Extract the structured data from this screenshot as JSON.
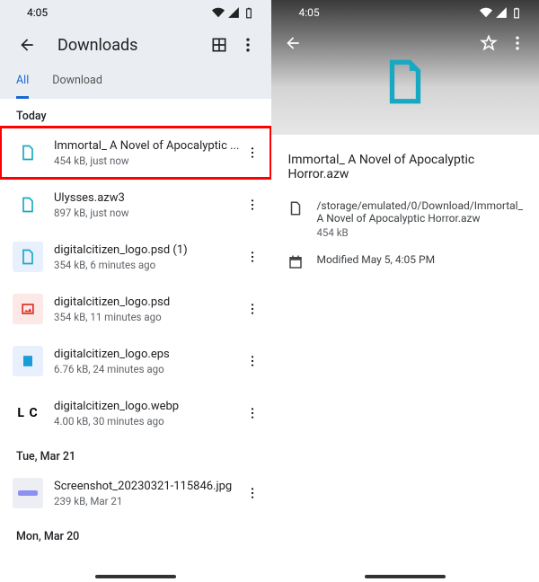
{
  "status": {
    "time": "4:05"
  },
  "left": {
    "title": "Downloads",
    "tabs": {
      "all": "All",
      "download": "Download"
    },
    "sections": {
      "today": "Today",
      "mar21": "Tue, Mar 21",
      "mar20": "Mon, Mar 20"
    },
    "files": {
      "f0": {
        "name": "Immortal_ A Novel of Apocalyptic ...",
        "meta": "454 kB, just now"
      },
      "f1": {
        "name": "Ulysses.azw3",
        "meta": "897 kB, just now"
      },
      "f2": {
        "name": "digitalcitizen_logo.psd (1)",
        "meta": "354 kB, 6 minutes ago"
      },
      "f3": {
        "name": "digitalcitizen_logo.psd",
        "meta": "354 kB, 11 minutes ago"
      },
      "f4": {
        "name": "digitalcitizen_logo.eps",
        "meta": "6.76 kB, 24 minutes ago"
      },
      "f5": {
        "name": "digitalcitizen_logo.webp",
        "meta": "4.00 kB, 30 minutes ago"
      },
      "f6": {
        "name": "Screenshot_20230321-115846.jpg",
        "meta": "239 kB, Mar 21"
      }
    }
  },
  "right": {
    "title": "Immortal_ A Novel of Apocalyptic Horror.azw",
    "path": "/storage/emulated/0/Download/Immortal_ A Novel of Apocalyptic Horror.azw",
    "size": "454 kB",
    "modified": "Modified May 5, 4:05 PM"
  }
}
